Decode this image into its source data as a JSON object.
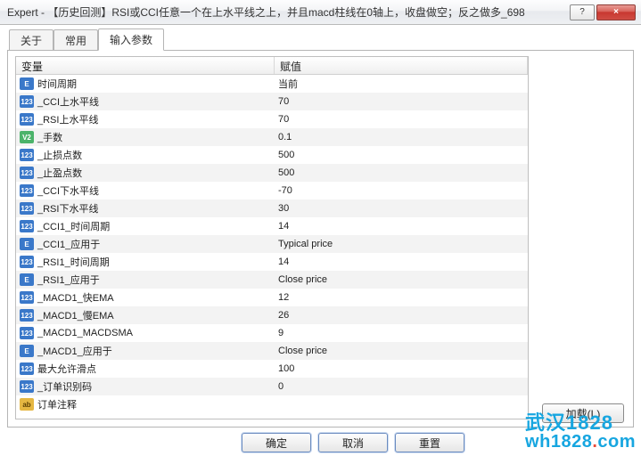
{
  "window": {
    "title": "Expert - 【历史回测】RSI或CCI任意一个在上水平线之上，并且macd柱线在0轴上，收盘做空；反之做多_698",
    "help_label": "?",
    "close_label": "×"
  },
  "tabs": [
    {
      "id": "about",
      "label": "关于",
      "active": false
    },
    {
      "id": "common",
      "label": "常用",
      "active": false
    },
    {
      "id": "inputs",
      "label": "输入参数",
      "active": true
    }
  ],
  "columns": {
    "variable": "变量",
    "value": "赋值"
  },
  "buttons": {
    "load": "加载(L)",
    "ok": "确定",
    "cancel": "取消",
    "reset": "重置"
  },
  "rows": [
    {
      "icon": "e",
      "name": "时间周期",
      "value": "当前"
    },
    {
      "icon": "123",
      "name": "_CCI上水平线",
      "value": "70"
    },
    {
      "icon": "123",
      "name": "_RSI上水平线",
      "value": "70"
    },
    {
      "icon": "v2",
      "name": "_手数",
      "value": "0.1"
    },
    {
      "icon": "123",
      "name": "_止损点数",
      "value": "500"
    },
    {
      "icon": "123",
      "name": "_止盈点数",
      "value": "500"
    },
    {
      "icon": "123",
      "name": "_CCI下水平线",
      "value": "-70"
    },
    {
      "icon": "123",
      "name": "_RSI下水平线",
      "value": "30"
    },
    {
      "icon": "123",
      "name": "_CCI1_时间周期",
      "value": "14"
    },
    {
      "icon": "e",
      "name": "_CCI1_应用于",
      "value": "Typical price"
    },
    {
      "icon": "123",
      "name": "_RSI1_时间周期",
      "value": "14"
    },
    {
      "icon": "e",
      "name": "_RSI1_应用于",
      "value": "Close price"
    },
    {
      "icon": "123",
      "name": "_MACD1_快EMA",
      "value": "12"
    },
    {
      "icon": "123",
      "name": "_MACD1_慢EMA",
      "value": "26"
    },
    {
      "icon": "123",
      "name": "_MACD1_MACDSMA",
      "value": "9"
    },
    {
      "icon": "e",
      "name": "_MACD1_应用于",
      "value": "Close price"
    },
    {
      "icon": "123",
      "name": "最大允许滑点",
      "value": "100"
    },
    {
      "icon": "123",
      "name": "_订单识别码",
      "value": "0"
    },
    {
      "icon": "ab",
      "name": "订单注释",
      "value": ""
    }
  ],
  "watermark": {
    "line1": "武汉1828",
    "line2_a": "wh1828",
    "line2_dot": ".",
    "line2_b": "com"
  }
}
